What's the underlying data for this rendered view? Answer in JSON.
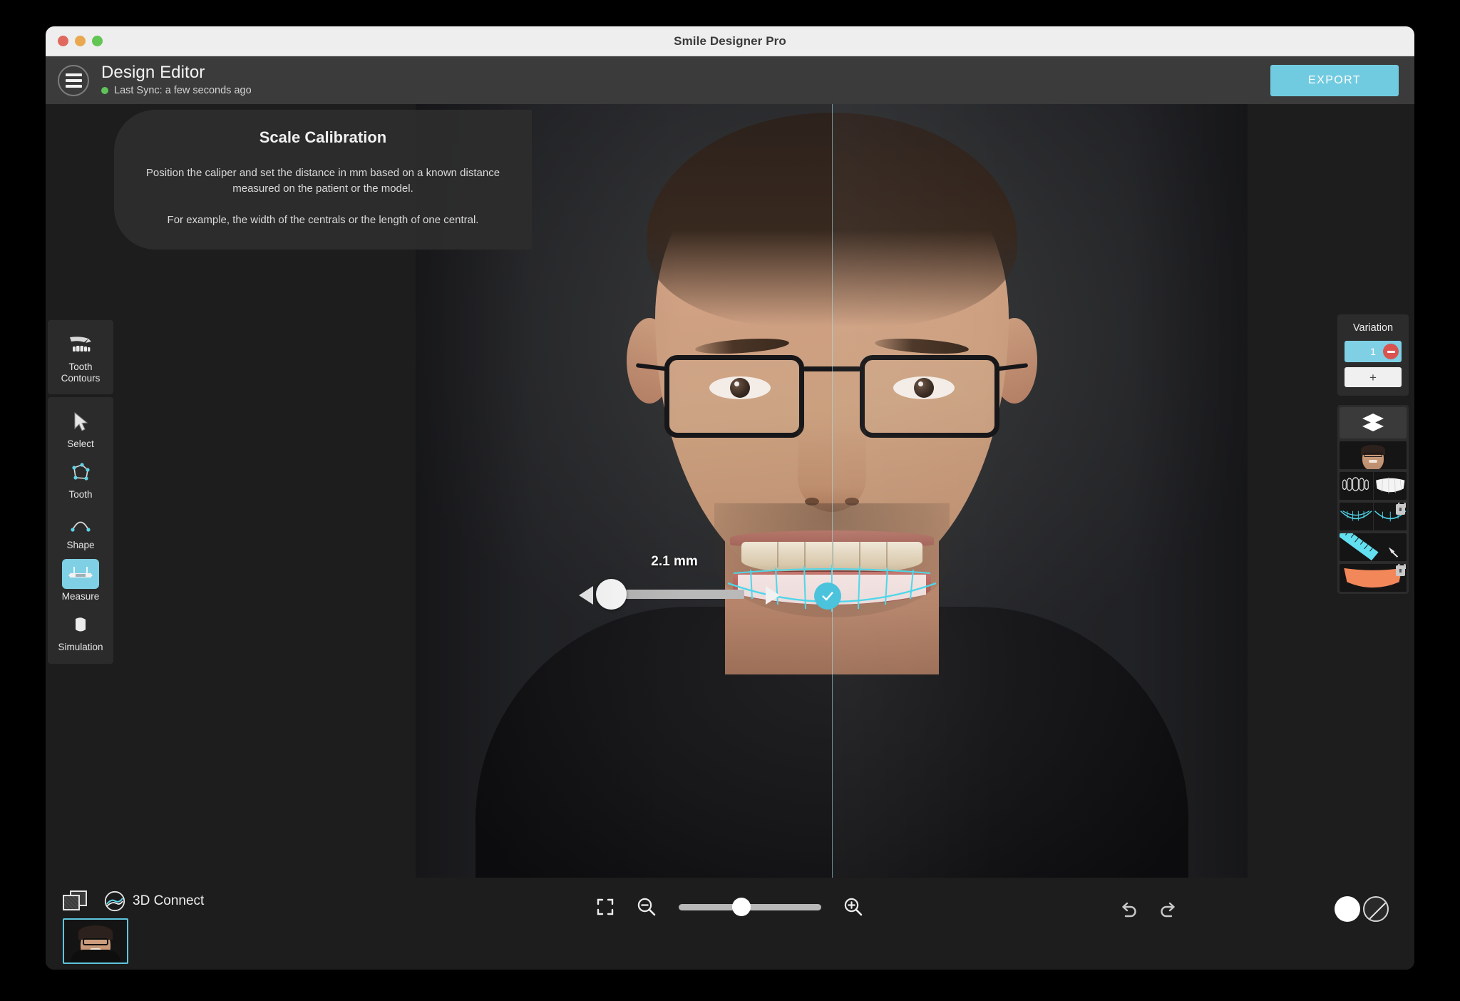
{
  "window": {
    "title": "Smile Designer Pro",
    "traffic_lights": [
      "close-red",
      "minimize-amber",
      "maximize-green"
    ]
  },
  "header": {
    "menu_icon": "hamburger-menu-icon",
    "page_title": "Design Editor",
    "sync_status": "Last Sync: a few seconds ago",
    "sync_dot_color": "#5ec45a",
    "export_label": "EXPORT",
    "export_color": "#71cbe0"
  },
  "calibration_panel": {
    "title": "Scale Calibration",
    "paragraph_1": "Position the caliper and set the distance in mm based on a known distance measured on the patient or the model.",
    "paragraph_2": "For example, the width of the centrals or the length of one central."
  },
  "toolbar": {
    "groups": [
      {
        "tools": [
          {
            "label": "Tooth\nContours",
            "label_line1": "Tooth",
            "label_line2": "Contours",
            "icon": "tooth-contours-icon",
            "active": false
          }
        ]
      },
      {
        "tools": [
          {
            "label": "Select",
            "icon": "cursor-arrow-icon",
            "active": false
          },
          {
            "label": "Tooth",
            "icon": "tooth-polygon-icon",
            "active": false
          },
          {
            "label": "Shape",
            "icon": "shape-curve-icon",
            "active": false
          },
          {
            "label": "Measure",
            "icon": "caliper-icon",
            "active": true
          },
          {
            "label": "Simulation",
            "icon": "simulation-tooth-icon",
            "active": false
          }
        ]
      }
    ]
  },
  "canvas": {
    "measurement_value": "2.1 mm",
    "caliper_handle_icon": "caliper-handle-icon",
    "confirm_icon": "check-circle-icon",
    "accent_color": "#4cc3dc",
    "midline_color": "#a8e2ec"
  },
  "variation_panel": {
    "title": "Variation",
    "items": [
      {
        "number": "1",
        "selected": true,
        "remove_icon": "minus-circle-icon",
        "remove_color": "#d9534f"
      }
    ],
    "add_label": "+"
  },
  "layers_panel": {
    "header_icon": "layers-stack-icon",
    "layers": [
      {
        "name": "photo-layer",
        "icon": "face-photo-icon",
        "locked": false
      },
      {
        "name": "teeth-outline-layer",
        "icon": "teeth-outline-icon",
        "locked": false
      },
      {
        "name": "arch-design-layer",
        "icon": "arch-curve-icon",
        "locked": true
      },
      {
        "name": "ruler-layer",
        "icon": "ruler-icon",
        "locked": false
      },
      {
        "name": "lip-mask-layer",
        "icon": "lip-mask-icon",
        "locked": true
      }
    ]
  },
  "bottom_bar": {
    "gallery_icon": "photo-stack-icon",
    "connect_icon": "3d-connect-globe-icon",
    "connect_label": "3D Connect",
    "fit_icon": "fit-to-screen-icon",
    "zoom_out_icon": "zoom-out-icon",
    "zoom_in_icon": "zoom-in-icon",
    "zoom_slider_percent": 44,
    "undo_icon": "undo-icon",
    "redo_icon": "redo-icon",
    "swatch_white": "#ffffff",
    "swatch_none": "no-color-icon",
    "filmstrip": [
      {
        "name": "patient-photo-thumbnail",
        "selected": true
      }
    ]
  }
}
